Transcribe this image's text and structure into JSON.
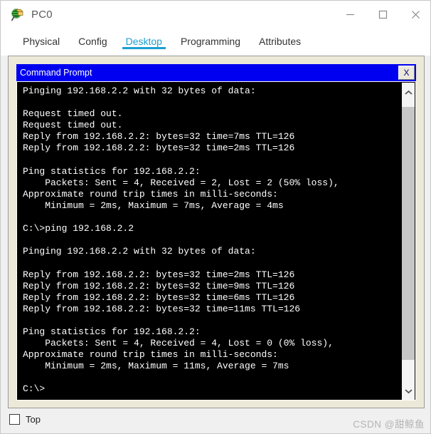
{
  "window": {
    "title": "PC0",
    "icon": "packet-tracer-icon",
    "controls": {
      "minimize": "minimize-icon",
      "maximize": "maximize-icon",
      "close": "close-icon"
    }
  },
  "tabs": [
    {
      "label": "Physical",
      "active": false
    },
    {
      "label": "Config",
      "active": false
    },
    {
      "label": "Desktop",
      "active": true
    },
    {
      "label": "Programming",
      "active": false
    },
    {
      "label": "Attributes",
      "active": false
    }
  ],
  "accent_color": "#1a9fd4",
  "cmd": {
    "title": "Command Prompt",
    "close_label": "X",
    "titlebar_color": "#0000f0",
    "background_color": "#000000",
    "text_color": "#ffffff",
    "lines": [
      "Pinging 192.168.2.2 with 32 bytes of data:",
      "",
      "Request timed out.",
      "Request timed out.",
      "Reply from 192.168.2.2: bytes=32 time=7ms TTL=126",
      "Reply from 192.168.2.2: bytes=32 time=2ms TTL=126",
      "",
      "Ping statistics for 192.168.2.2:",
      "    Packets: Sent = 4, Received = 2, Lost = 2 (50% loss),",
      "Approximate round trip times in milli-seconds:",
      "    Minimum = 2ms, Maximum = 7ms, Average = 4ms",
      "",
      "C:\\>ping 192.168.2.2",
      "",
      "Pinging 192.168.2.2 with 32 bytes of data:",
      "",
      "Reply from 192.168.2.2: bytes=32 time=2ms TTL=126",
      "Reply from 192.168.2.2: bytes=32 time=9ms TTL=126",
      "Reply from 192.168.2.2: bytes=32 time=6ms TTL=126",
      "Reply from 192.168.2.2: bytes=32 time=11ms TTL=126",
      "",
      "Ping statistics for 192.168.2.2:",
      "    Packets: Sent = 4, Received = 4, Lost = 0 (0% loss),",
      "Approximate round trip times in milli-seconds:",
      "    Minimum = 2ms, Maximum = 11ms, Average = 7ms",
      "",
      "C:\\>"
    ],
    "scrollbar": {
      "up_arrow": "chevron-up-icon",
      "down_arrow": "chevron-down-icon"
    }
  },
  "footer": {
    "checkbox_label": "Top",
    "checkbox_checked": false,
    "watermark": "CSDN @甜鲸鱼"
  }
}
